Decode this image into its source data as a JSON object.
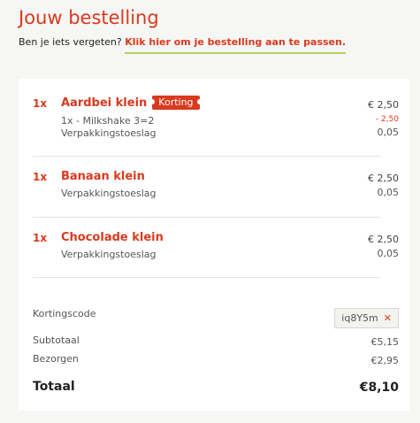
{
  "header": {
    "title": "Jouw bestelling",
    "prompt": "Ben je iets vergeten?",
    "edit_link": "Klik hier om je bestelling aan te passen."
  },
  "items": [
    {
      "qty": "1x",
      "name": "Aardbei klein",
      "badge": "Korting",
      "price": "€ 2,50",
      "lines": [
        {
          "text": "1x - Milkshake 3=2",
          "price": "- 2,50"
        },
        {
          "text": "Verpakkingstoeslag",
          "price": "0,05"
        }
      ]
    },
    {
      "qty": "1x",
      "name": "Banaan klein",
      "price": "€ 2,50",
      "lines": [
        {
          "text": "Verpakkingstoeslag",
          "price": "0,05"
        }
      ]
    },
    {
      "qty": "1x",
      "name": "Chocolade klein",
      "price": "€ 2,50",
      "lines": [
        {
          "text": "Verpakkingstoeslag",
          "price": "0,05"
        }
      ]
    }
  ],
  "summary": {
    "discount_code_label": "Kortingscode",
    "discount_code_value": "iq8Y5m",
    "subtotal_label": "Subtotaal",
    "subtotal_value": "€5,15",
    "delivery_label": "Bezorgen",
    "delivery_value": "€2,95",
    "total_label": "Totaal",
    "total_value": "€8,10"
  },
  "colors": {
    "accent": "#d83a1e",
    "underline": "#b7d36a",
    "background": "#f6f6f4"
  },
  "icons": {
    "remove_code": "close-icon"
  }
}
